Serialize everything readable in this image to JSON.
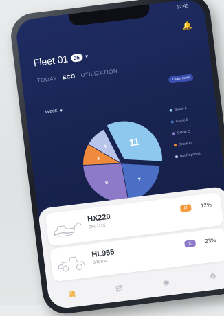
{
  "status": {
    "time": "12:45"
  },
  "header": {
    "fleet_name": "Fleet 01",
    "fleet_count": "35"
  },
  "tabs": [
    {
      "label": "TODAY",
      "active": false
    },
    {
      "label": "ECO",
      "active": true
    },
    {
      "label": "UTILIZATION",
      "active": false
    }
  ],
  "learn_more_label": "Learn more",
  "period": {
    "selected": "Week"
  },
  "chart_data": {
    "type": "pie",
    "slices": [
      {
        "label": "Grade A",
        "value": 11,
        "color": "#8ec8ef"
      },
      {
        "label": "Grade B",
        "value": 7,
        "color": "#4a6fc4"
      },
      {
        "label": "Grade C",
        "value": 9,
        "color": "#8d7ac8"
      },
      {
        "label": "Grade D",
        "value": 3,
        "color": "#f08a3c"
      },
      {
        "label": "Not Reported",
        "value": 3,
        "color": "#b9c4ea"
      }
    ],
    "legend_placement": "right"
  },
  "machines": [
    {
      "name": "HX220",
      "serial": "S/N 3216",
      "badge_color": "#f39a3f",
      "badge_text": "D",
      "percent": "12%"
    },
    {
      "name": "HL955",
      "serial": "S/N 934",
      "badge_color": "#8d7ac8",
      "badge_text": "C",
      "percent": "23%"
    }
  ],
  "nav_icons": [
    "dashboard-icon",
    "document-icon",
    "location-icon",
    "settings-icon"
  ]
}
